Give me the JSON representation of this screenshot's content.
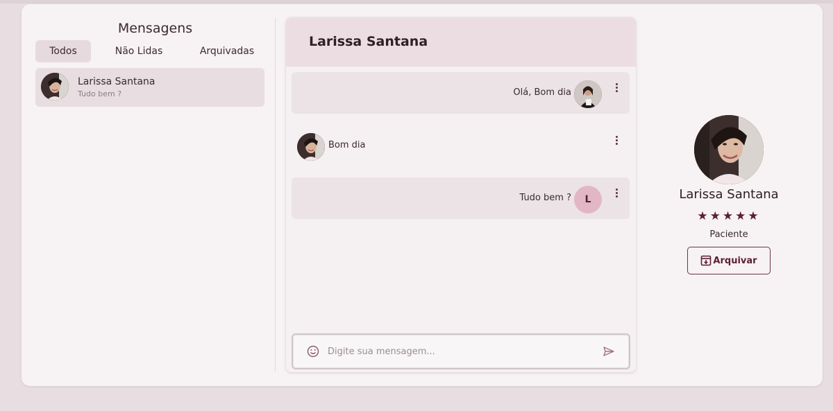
{
  "sidebar": {
    "title": "Mensagens",
    "tabs": [
      {
        "label": "Todos"
      },
      {
        "label": "Não Lidas"
      },
      {
        "label": "Arquivadas"
      }
    ],
    "conversations": [
      {
        "name": "Larissa Santana",
        "preview": "Tudo bem ?"
      }
    ]
  },
  "chat": {
    "title": "Larissa Santana",
    "messages": [
      {
        "text": "Olá, Bom dia",
        "side": "right",
        "avatar": "photo"
      },
      {
        "text": "Bom dia",
        "side": "left",
        "avatar": "photo"
      },
      {
        "text": "Tudo bem ?",
        "side": "right",
        "avatar_letter": "L"
      }
    ],
    "composer": {
      "placeholder": "Digite sua mensagem..."
    }
  },
  "profile": {
    "name": "Larissa Santana",
    "rating": 5,
    "stars": "★★★★★",
    "role": "Paciente",
    "archive_label": "Arquivar"
  },
  "colors": {
    "background": "#e8dee2",
    "accent": "#5a1e35",
    "avatar_letter_bg": "#e3b6c6"
  },
  "icons": {
    "emoji": "smile-icon",
    "send": "send-icon",
    "menu": "more-vertical-icon",
    "archive": "archive-icon"
  }
}
